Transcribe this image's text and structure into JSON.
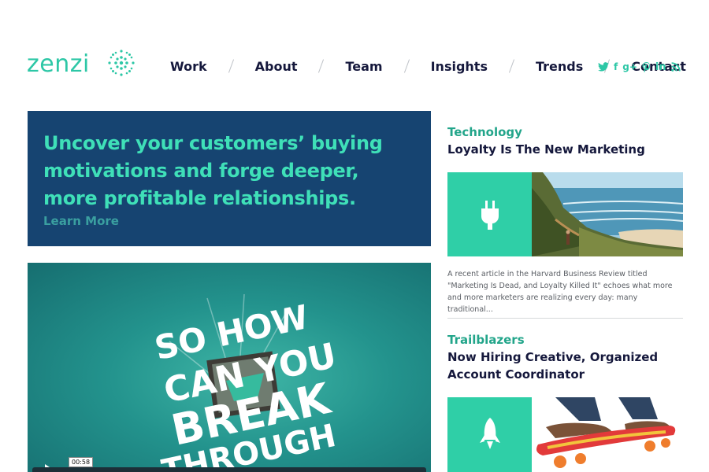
{
  "brand": {
    "name": "zenzi",
    "accent": "#2dc7a6"
  },
  "nav": {
    "items": [
      {
        "label": "Work"
      },
      {
        "label": "About"
      },
      {
        "label": "Team"
      },
      {
        "label": "Insights"
      },
      {
        "label": "Trends"
      },
      {
        "label": "Contact"
      }
    ]
  },
  "social": {
    "icons": [
      "twitter-icon",
      "facebook-icon",
      "google-plus-icon",
      "pinterest-icon",
      "linkedin-icon",
      "rss-icon"
    ],
    "labels": {
      "facebook": "f",
      "google_plus": "g+",
      "linkedin": "in"
    }
  },
  "hero": {
    "headline": "Uncover your customers’ buying motivations and forge deeper, more profitable relationships.",
    "link": "Learn More",
    "background": "#164471",
    "text_color": "#3fe0b8"
  },
  "video": {
    "lettering": [
      "SO HOW",
      "CAN YOU",
      "BREAK",
      "THROUGH"
    ],
    "time": "00:58"
  },
  "articles": [
    {
      "category": "Technology",
      "title": "Loyalty Is The New Marketing",
      "icon": "plug-icon",
      "image": "coastal-cliff-photo",
      "excerpt": "A recent article in the Harvard Business Review titled \"Marketing Is Dead, and Loyalty Killed It\" echoes what more and more marketers are realizing every day: many traditional..."
    },
    {
      "category": "Trailblazers",
      "title": "Now Hiring Creative, Organized Account Coordinator",
      "icon": "rocket-icon",
      "image": "skateboard-photo"
    }
  ]
}
